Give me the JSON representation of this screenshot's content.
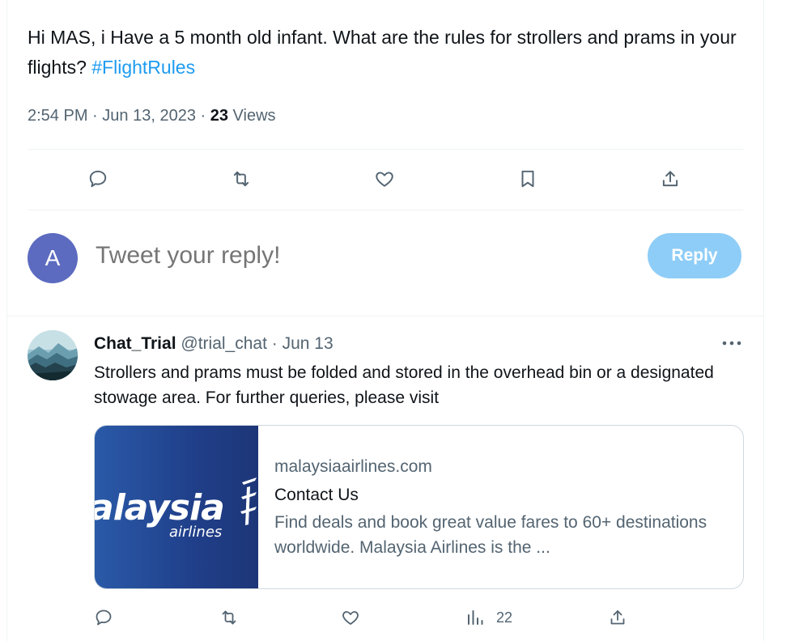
{
  "tweet": {
    "text": "Hi MAS, i Have a 5 month old infant. What are the rules for strollers and prams in your flights?",
    "hashtag": "#FlightRules",
    "time": "2:54 PM",
    "date": "Jun 13, 2023",
    "views_count": "23",
    "views_label": "Views"
  },
  "compose": {
    "avatar_letter": "A",
    "placeholder": "Tweet your reply!",
    "reply_button": "Reply"
  },
  "reply": {
    "name": "Chat_Trial",
    "handle": "@trial_chat",
    "date": "Jun 13",
    "text": "Strollers and prams must be folded and stored in the overhead bin or a designated stowage area. For further queries, please visit",
    "card": {
      "logo_text": "alaysia",
      "logo_sub": "airlines",
      "domain": "malaysiaairlines.com",
      "title": "Contact Us",
      "description": "Find deals and book great value fares to 60+ destinations worldwide. Malaysia Airlines is the ..."
    },
    "views_count": "22"
  },
  "icons": {
    "reply": "comment-icon",
    "retweet": "retweet-icon",
    "like": "heart-icon",
    "bookmark": "bookmark-icon",
    "share": "share-icon",
    "analytics": "analytics-icon",
    "more": "more-icon"
  },
  "colors": {
    "accent": "#1d9bf0",
    "reply_button_disabled": "#8ecdf7",
    "text_secondary": "#536471",
    "avatar": "#5c6bc0"
  }
}
